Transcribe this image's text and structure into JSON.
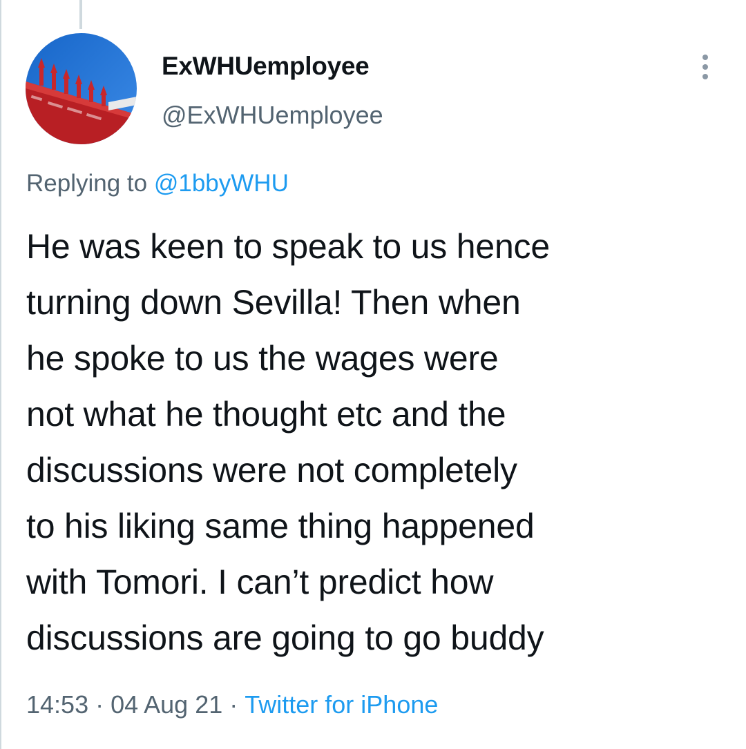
{
  "author": {
    "display_name": "ExWHUemployee",
    "handle": "@ExWHUemployee"
  },
  "reply": {
    "prefix": "Replying to",
    "to_handle": "@1bbyWHU"
  },
  "tweet": {
    "lines": [
      "He was keen to speak to us hence",
      "turning down Sevilla! Then when",
      "he spoke to us the wages were",
      "not what he thought etc and the",
      "discussions were not completely",
      "to his liking same thing happened",
      "with Tomori. I can’t predict how",
      "discussions are going to go buddy"
    ]
  },
  "meta": {
    "time": "14:53",
    "separator": "·",
    "date": "04 Aug 21",
    "source": "Twitter for iPhone"
  },
  "icons": {
    "more": "more-vertical-icon"
  },
  "colors": {
    "text": "#0f1419",
    "secondary": "#536471",
    "link": "#1d9bf0",
    "avatar_sky": "#1f6fd6",
    "avatar_red": "#c8272b"
  }
}
